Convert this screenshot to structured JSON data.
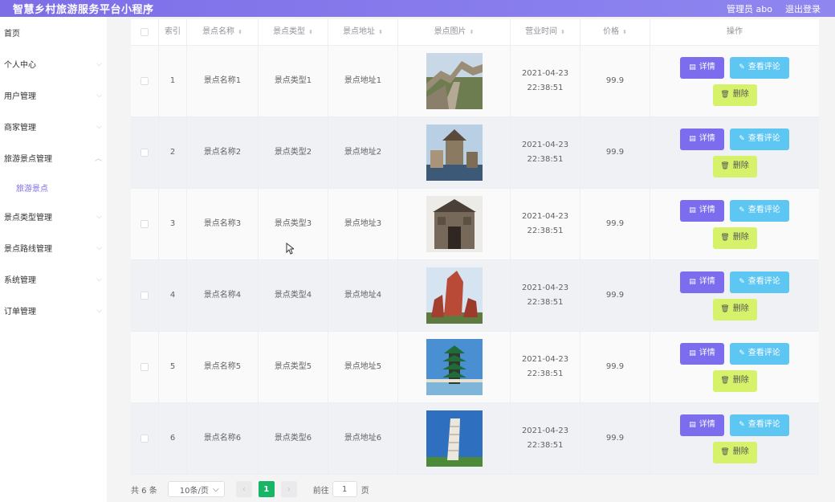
{
  "header": {
    "title": "智慧乡村旅游服务平台小程序",
    "user": "管理员 abo",
    "logout": "退出登录"
  },
  "sidebar": {
    "items": [
      {
        "label": "首页",
        "arrow": false
      },
      {
        "label": "个人中心",
        "arrow": "down"
      },
      {
        "label": "用户管理",
        "arrow": "down"
      },
      {
        "label": "商家管理",
        "arrow": "down"
      },
      {
        "label": "旅游景点管理",
        "arrow": "up"
      },
      {
        "label": "旅游景点",
        "sub": true
      },
      {
        "label": "景点类型管理",
        "arrow": "down"
      },
      {
        "label": "景点路线管理",
        "arrow": "down"
      },
      {
        "label": "系统管理",
        "arrow": "down"
      },
      {
        "label": "订单管理",
        "arrow": "down"
      }
    ]
  },
  "table": {
    "columns": [
      "",
      "索引",
      "景点名称",
      "景点类型",
      "景点地址",
      "景点图片",
      "营业时间",
      "价格",
      "操作"
    ],
    "rows": [
      {
        "index": "1",
        "name": "景点名称1",
        "type": "景点类型1",
        "address": "景点地址1",
        "time": "2021-04-23 22:38:51",
        "price": "99.9",
        "image": "great-wall"
      },
      {
        "index": "2",
        "name": "景点名称2",
        "type": "景点类型2",
        "address": "景点地址2",
        "time": "2021-04-23 22:38:51",
        "price": "99.9",
        "image": "tower-lake"
      },
      {
        "index": "3",
        "name": "景点名称3",
        "type": "景点类型3",
        "address": "景点地址3",
        "time": "2021-04-23 22:38:51",
        "price": "99.9",
        "image": "stone-gate"
      },
      {
        "index": "4",
        "name": "景点名称4",
        "type": "景点类型4",
        "address": "景点地址4",
        "time": "2021-04-23 22:38:51",
        "price": "99.9",
        "image": "red-rock"
      },
      {
        "index": "5",
        "name": "景点名称5",
        "type": "景点类型5",
        "address": "景点地址5",
        "time": "2021-04-23 22:38:51",
        "price": "99.9",
        "image": "pagoda"
      },
      {
        "index": "6",
        "name": "景点名称6",
        "type": "景点类型6",
        "address": "景点地址6",
        "time": "2021-04-23 22:38:51",
        "price": "99.9",
        "image": "leaning-tower"
      }
    ],
    "buttons": {
      "detail": "详情",
      "comment": "查看评论",
      "delete": "删除"
    }
  },
  "pagination": {
    "total": "共 6 条",
    "page_size": "10条/页",
    "current": "1",
    "goto_prefix": "前往",
    "goto_value": "1",
    "goto_suffix": "页"
  },
  "colors": {
    "header": "#7d6ee8",
    "detail": "#7b6ded",
    "comment": "#5ec6f2",
    "delete": "#d6f26a",
    "active_page": "#18b566"
  }
}
